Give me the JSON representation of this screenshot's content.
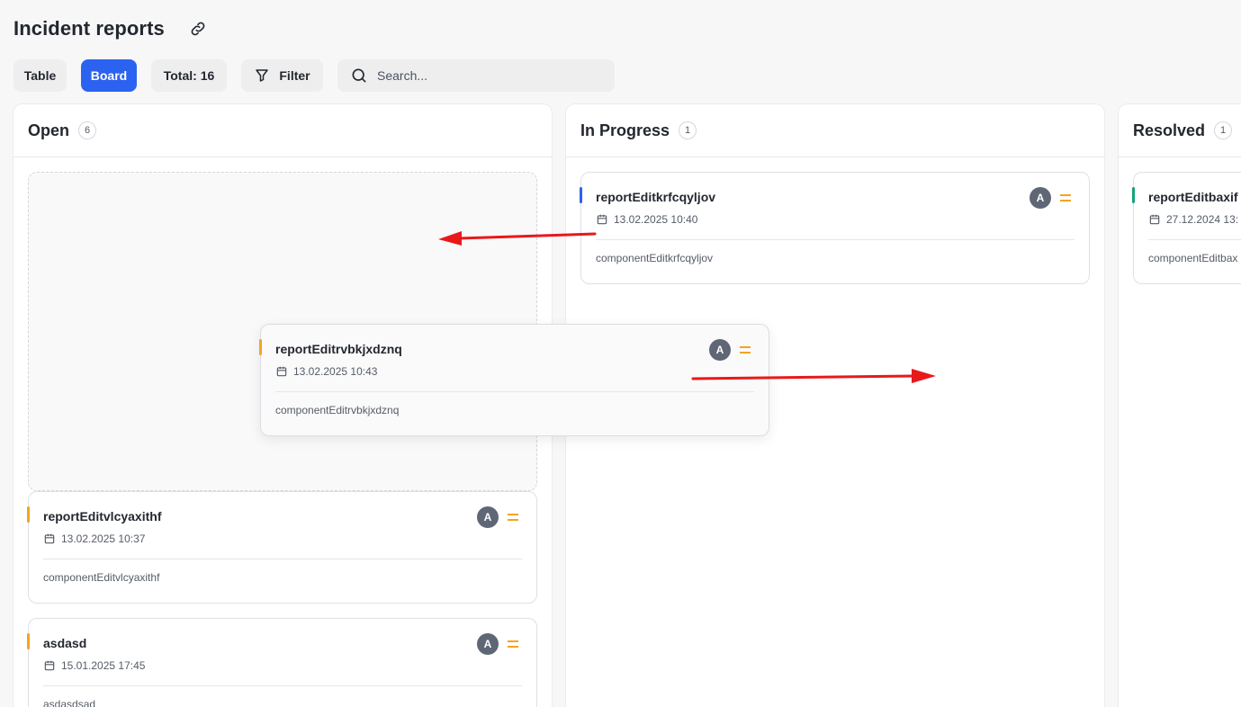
{
  "page": {
    "title": "Incident reports",
    "link_icon": "link-icon"
  },
  "toolbar": {
    "table_label": "Table",
    "board_label": "Board",
    "total_label": "Total: 16",
    "filter_label": "Filter",
    "search_placeholder": "Search...",
    "active_view": "Board"
  },
  "colors": {
    "accent": "#2c62f0",
    "priority": "#f2a51f",
    "open": "#f2a51f",
    "in_progress": "#2c62f0",
    "resolved": "#14a37f",
    "arrow": "#e8191a"
  },
  "columns": [
    {
      "title": "Open",
      "count": "6",
      "cards": [
        {
          "title": "reportEditvlcyaxithf",
          "date": "13.02.2025 10:37",
          "component": "componentEditvlcyaxithf",
          "assignee": "A"
        },
        {
          "title": "asdasd",
          "date": "15.01.2025 17:45",
          "component": "asdasdsad",
          "assignee": "A"
        }
      ]
    },
    {
      "title": "In Progress",
      "count": "1",
      "cards": [
        {
          "title": "reportEditkrfcqyljov",
          "date": "13.02.2025 10:40",
          "component": "componentEditkrfcqyljov",
          "assignee": "A"
        }
      ]
    },
    {
      "title": "Resolved",
      "count": "1",
      "cards": [
        {
          "title": "reportEditbaxif",
          "date": "27.12.2024 13:",
          "component": "componentEditbax",
          "assignee": ""
        }
      ]
    }
  ],
  "dragging_card": {
    "title": "reportEditrvbkjxdznq",
    "date": "13.02.2025 10:43",
    "component": "componentEditrvbkjxdznq",
    "assignee": "A"
  }
}
